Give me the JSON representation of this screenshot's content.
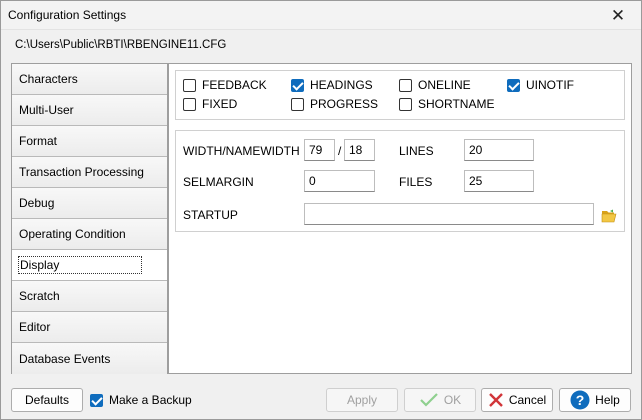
{
  "window": {
    "title": "Configuration Settings",
    "close_glyph": "✕"
  },
  "path": "C:\\Users\\Public\\RBTI\\RBENGINE11.CFG",
  "tabs": [
    {
      "label": "Characters",
      "active": false
    },
    {
      "label": "Multi-User",
      "active": false
    },
    {
      "label": "Format",
      "active": false
    },
    {
      "label": "Transaction Processing",
      "active": false
    },
    {
      "label": "Debug",
      "active": false
    },
    {
      "label": "Operating Condition",
      "active": false
    },
    {
      "label": "Display",
      "active": true
    },
    {
      "label": "Scratch",
      "active": false
    },
    {
      "label": "Editor",
      "active": false
    },
    {
      "label": "Database Events",
      "active": false
    }
  ],
  "checkboxes": [
    {
      "label": "FEEDBACK",
      "checked": false
    },
    {
      "label": "HEADINGS",
      "checked": true
    },
    {
      "label": "ONELINE",
      "checked": false
    },
    {
      "label": "UINOTIF",
      "checked": true
    },
    {
      "label": "FIXED",
      "checked": false
    },
    {
      "label": "PROGRESS",
      "checked": false
    },
    {
      "label": "SHORTNAME",
      "checked": false
    }
  ],
  "fields": {
    "width_label": "WIDTH/NAMEWIDTH",
    "width_value": "79",
    "separator": "/",
    "namewidth_value": "18",
    "lines_label": "LINES",
    "lines_value": "20",
    "selmargin_label": "SELMARGIN",
    "selmargin_value": "0",
    "files_label": "FILES",
    "files_value": "25",
    "startup_label": "STARTUP",
    "startup_value": ""
  },
  "buttons": {
    "defaults": "Defaults",
    "make_backup": "Make a Backup",
    "make_backup_checked": true,
    "apply": "Apply",
    "ok": "OK",
    "cancel": "Cancel",
    "help": "Help"
  },
  "colors": {
    "accent": "#0f6cbd",
    "cancel_red": "#d13438",
    "ok_green": "#5fb95f",
    "folder": "#e8b923"
  }
}
